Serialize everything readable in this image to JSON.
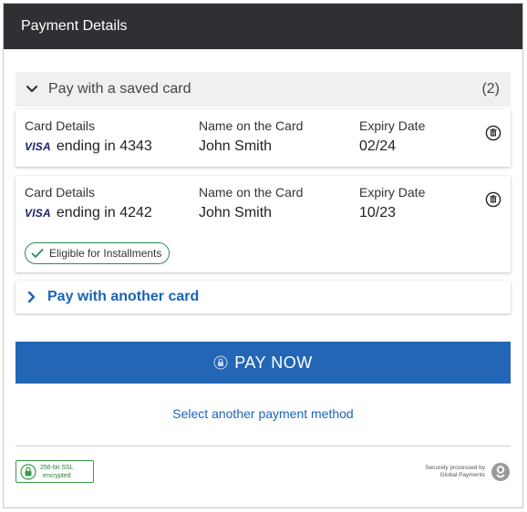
{
  "header": {
    "title": "Payment Details"
  },
  "saved": {
    "title": "Pay with a saved card",
    "count": "(2)",
    "cards": [
      {
        "details_label": "Card Details",
        "brand": "VISA",
        "ending": "ending in 4343",
        "name_label": "Name on the Card",
        "name": "John Smith",
        "expiry_label": "Expiry Date",
        "expiry": "02/24"
      },
      {
        "details_label": "Card Details",
        "brand": "VISA",
        "ending": "ending in 4242",
        "name_label": "Name on the Card",
        "name": "John Smith",
        "expiry_label": "Expiry Date",
        "expiry": "10/23",
        "badge": "Eligible for Installments"
      }
    ]
  },
  "another_card": {
    "label": "Pay with another card"
  },
  "pay_button": {
    "label": "PAY NOW"
  },
  "alt_method": {
    "label": "Select another payment method"
  },
  "footer": {
    "ssl_line1": "256-bit SSL",
    "ssl_line2": "encrypted",
    "gp_line1": "Securely processed by",
    "gp_line2": "Global Payments"
  },
  "colors": {
    "header_bg": "#2f3033",
    "primary": "#2266b5",
    "link": "#1a63b8",
    "success": "#2e8b57"
  },
  "icons": {
    "saved_toggle": "chevron-down-icon",
    "another_toggle": "chevron-right-icon",
    "delete": "trash-icon",
    "badge": "check-icon",
    "pay": "lock-icon",
    "ssl": "padlock-icon",
    "gp": "global-payments-logo"
  }
}
